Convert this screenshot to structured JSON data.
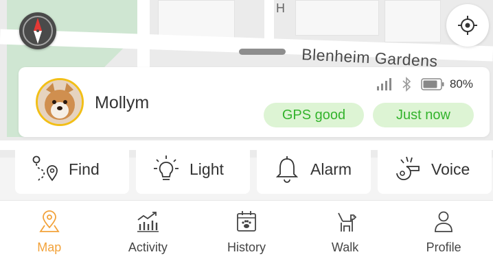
{
  "map": {
    "street_label": "Blenheim Gardens",
    "marker_glyph": "H"
  },
  "pet": {
    "name": "Mollym",
    "battery": "80%",
    "gps_status": "GPS good",
    "last_update": "Just now"
  },
  "actions": [
    {
      "label": "Find",
      "icon": "route-pin-icon"
    },
    {
      "label": "Light",
      "icon": "lightbulb-icon"
    },
    {
      "label": "Alarm",
      "icon": "bell-icon"
    },
    {
      "label": "Voice",
      "icon": "whistle-icon"
    }
  ],
  "tabs": [
    {
      "label": "Map",
      "icon": "map-pin-icon",
      "active": true
    },
    {
      "label": "Activity",
      "icon": "activity-chart-icon",
      "active": false
    },
    {
      "label": "History",
      "icon": "calendar-paw-icon",
      "active": false
    },
    {
      "label": "Walk",
      "icon": "dog-walk-icon",
      "active": false
    },
    {
      "label": "Profile",
      "icon": "person-icon",
      "active": false
    }
  ],
  "colors": {
    "accent": "#f2a23a",
    "status_green": "#33b32c",
    "status_chip_bg": "#ddf4d4",
    "avatar_ring": "#f2bf17"
  }
}
